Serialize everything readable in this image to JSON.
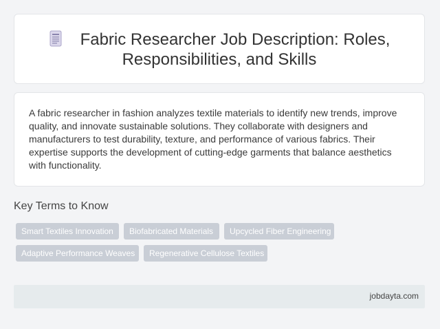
{
  "header": {
    "icon": "document-icon",
    "title_line1": "Fabric Researcher Job Description: Roles,",
    "title_line2": "Responsibilities, and Skills"
  },
  "description": "A fabric researcher in fashion analyzes textile materials to identify new trends, improve quality, and innovate sustainable solutions. They collaborate with designers and manufacturers to test durability, texture, and performance of various fabrics. Their expertise supports the development of cutting-edge garments that balance aesthetics with functionality.",
  "key_terms": {
    "heading": "Key Terms to Know",
    "tags": [
      "Smart Textiles Innovation",
      "Biofabricated Materials",
      "Upcycled Fiber Engineering",
      "Adaptive Performance Weaves",
      "Regenerative Cellulose Textiles"
    ]
  },
  "footer": {
    "site": "jobdayta.com"
  },
  "colors": {
    "tag_bg": "#c9ced6",
    "footer_bg": "#e6ebed",
    "page_bg": "#f3f4f6"
  }
}
